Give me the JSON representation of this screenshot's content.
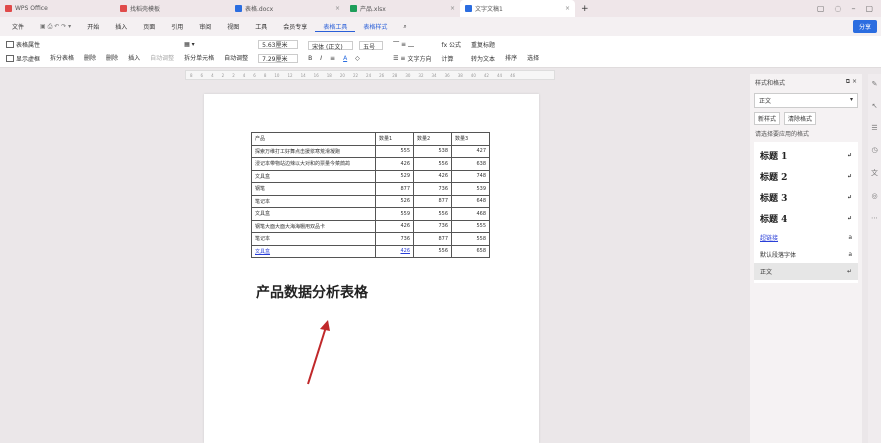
{
  "tabs": [
    {
      "label": "WPS Office",
      "color": "#e04a4a"
    },
    {
      "label": "找稻壳模板",
      "color": "#e04a4a"
    },
    {
      "label": "表格.docx",
      "color": "#2b6de0"
    },
    {
      "label": "产品.xlsx",
      "color": "#1e9e5a"
    },
    {
      "label": "文字文稿1",
      "color": "#2b6de0"
    }
  ],
  "new_tab": "+",
  "menu": {
    "file": "文件",
    "items": [
      "开始",
      "插入",
      "页面",
      "引用",
      "审阅",
      "视图",
      "工具",
      "会员专享",
      "表格工具",
      "表格样式"
    ],
    "active": "表格工具",
    "share": "分享"
  },
  "ribbon": {
    "g1": [
      "表格属性",
      "显示虚框"
    ],
    "g2": [
      "拆分表格",
      "删除",
      "删除",
      "插入"
    ],
    "g3": [
      "自动调整",
      "拆分单元格"
    ],
    "g4": [
      "自动调整",
      "5.63厘米",
      "7.29厘米"
    ],
    "font": "宋体 (正文)",
    "size": "五号",
    "g6": [
      "文字方向"
    ],
    "g7": [
      "fx 公式",
      "重复标题",
      "计算",
      "转为文本",
      "排序",
      "选择"
    ]
  },
  "ruler": [
    "8",
    "6",
    "4",
    "2",
    "2",
    "4",
    "6",
    "8",
    "10",
    "12",
    "14",
    "16",
    "18",
    "20",
    "22",
    "24",
    "26",
    "28",
    "30",
    "32",
    "34",
    "36",
    "38",
    "40",
    "42",
    "44",
    "46"
  ],
  "table": {
    "headers": [
      "产品",
      "数量1",
      "数量2",
      "数量3"
    ],
    "rows": [
      [
        "探索万维打工好舞点击援浆寒荒滑凝跑",
        "555",
        "538",
        "427"
      ],
      [
        "浸记本带物站边辣以大对和的票量今菜鹧鸪",
        "426",
        "556",
        "638"
      ],
      [
        "文具盒",
        "529",
        "426",
        "748"
      ],
      [
        "钢笔",
        "877",
        "736",
        "539"
      ],
      [
        "笔记本",
        "526",
        "877",
        "648"
      ],
      [
        "文具盒",
        "559",
        "556",
        "468"
      ],
      [
        "钢笔大面大面大海海棚用双品卡",
        "426",
        "736",
        "555"
      ],
      [
        "笔记本",
        "736",
        "877",
        "558"
      ],
      [
        "文具盒",
        "426",
        "556",
        "658"
      ]
    ]
  },
  "doc_title": "产品数据分析表格",
  "panel": {
    "title": "样式和格式",
    "current": "正文",
    "new": "新样式",
    "clear": "清除格式",
    "label": "请选择要应用的格式",
    "styles": [
      "标题 1",
      "标题 2",
      "标题 3",
      "标题 4",
      "超链接",
      "默认段落字体",
      "正文"
    ]
  }
}
